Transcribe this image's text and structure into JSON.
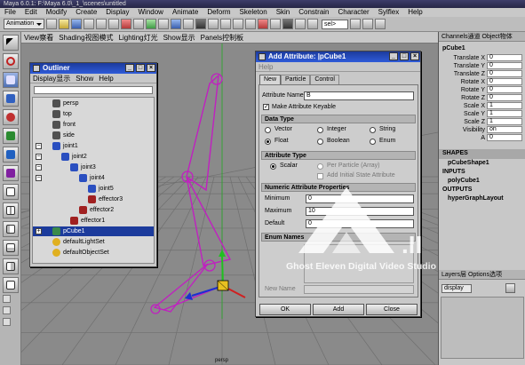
{
  "app": {
    "title": "Maya 6.0.1: F:\\Maya 6.0\\_1_\\scenes\\untitled",
    "window_title": "pCube1"
  },
  "menubar": [
    "File",
    "Edit",
    "Modify",
    "Create",
    "Display",
    "Window",
    "Animate",
    "Deform",
    "Skeleton",
    "Skin",
    "Constrain",
    "Character",
    "Sylflex",
    "Help"
  ],
  "statusline": {
    "mode": "Animation",
    "field": "sel>"
  },
  "viewport": {
    "menu": [
      "View察看",
      "Shading视图模式",
      "Lighting灯光",
      "Show显示",
      "Panels控制板"
    ],
    "camera_label": "persp"
  },
  "outliner": {
    "title": "Outliner",
    "menu": [
      "Display显示",
      "Show",
      "Help"
    ],
    "items": [
      {
        "label": "persp",
        "icon": "camera-icon"
      },
      {
        "label": "top",
        "icon": "camera-icon"
      },
      {
        "label": "front",
        "icon": "camera-icon"
      },
      {
        "label": "side",
        "icon": "camera-icon"
      },
      {
        "label": "joint1",
        "icon": "joint-icon",
        "expander": "−"
      },
      {
        "label": "joint2",
        "icon": "joint-icon",
        "expander": "−"
      },
      {
        "label": "joint3",
        "icon": "joint-icon",
        "expander": "−"
      },
      {
        "label": "joint4",
        "icon": "joint-icon",
        "expander": "−"
      },
      {
        "label": "joint5",
        "icon": "joint-icon"
      },
      {
        "label": "effector3",
        "icon": "effector-icon"
      },
      {
        "label": "effector2",
        "icon": "effector-icon"
      },
      {
        "label": "effector1",
        "icon": "effector-icon"
      },
      {
        "label": "pCube1",
        "icon": "cube-icon",
        "expander": "+",
        "selected": true
      },
      {
        "label": "defaultLightSet",
        "icon": "set-icon"
      },
      {
        "label": "defaultObjectSet",
        "icon": "set-icon"
      }
    ]
  },
  "add_attribute": {
    "title": "Add Attribute: |pCube1",
    "menu": "Help",
    "tabs": [
      "New",
      "Particle",
      "Control"
    ],
    "attribute_name_label": "Attribute Name",
    "attribute_name_value": "B",
    "make_keyable_label": "Make Attribute Keyable",
    "make_keyable_checked": true,
    "data_type_header": "Data Type",
    "data_types": [
      "Vector",
      "Integer",
      "String",
      "Float",
      "Boolean",
      "Enum"
    ],
    "data_type_selected": "Float",
    "attribute_type_header": "Attribute Type",
    "attribute_types": [
      "Scalar",
      "Per Particle (Array)",
      "Add Initial State Attribute"
    ],
    "attribute_type_selected": "Scalar",
    "numeric_header": "Numeric Attribute Properties",
    "minimum_label": "Minimum",
    "minimum_value": "0",
    "maximum_label": "Maximum",
    "maximum_value": "10",
    "default_label": "Default",
    "default_value": "0",
    "enum_header": "Enum Names",
    "new_name_label": "New Name",
    "buttons": [
      "OK",
      "Add",
      "Close"
    ]
  },
  "channel_box": {
    "header": "Channels通道  Object物体",
    "object": "pCube1",
    "channels": [
      {
        "name": "Translate X",
        "value": "0"
      },
      {
        "name": "Translate Y",
        "value": "0"
      },
      {
        "name": "Translate Z",
        "value": "0"
      },
      {
        "name": "Rotate X",
        "value": "0"
      },
      {
        "name": "Rotate Y",
        "value": "0"
      },
      {
        "name": "Rotate Z",
        "value": "0"
      },
      {
        "name": "Scale X",
        "value": "1"
      },
      {
        "name": "Scale Y",
        "value": "1"
      },
      {
        "name": "Scale Z",
        "value": "1"
      },
      {
        "name": "Visibility",
        "value": "on"
      },
      {
        "name": "A",
        "value": "0"
      }
    ],
    "shapes_label": "SHAPES",
    "shape": "pCubeShape1",
    "inputs_label": "INPUTS",
    "input": "polyCube1",
    "outputs_label": "OUTPUTS",
    "output": "hyperGraphLayout",
    "layers_header": "Layers层  Options选项",
    "layer_display": "display"
  },
  "watermark": {
    "text": "Ghost Eleven Digital Video Studio",
    "mark": ".II"
  },
  "colors": {
    "title_blue": "#2f5bd8",
    "skeleton": "#c020c0",
    "selection": "#1c3b9c",
    "panel": "#c8c8c8"
  }
}
